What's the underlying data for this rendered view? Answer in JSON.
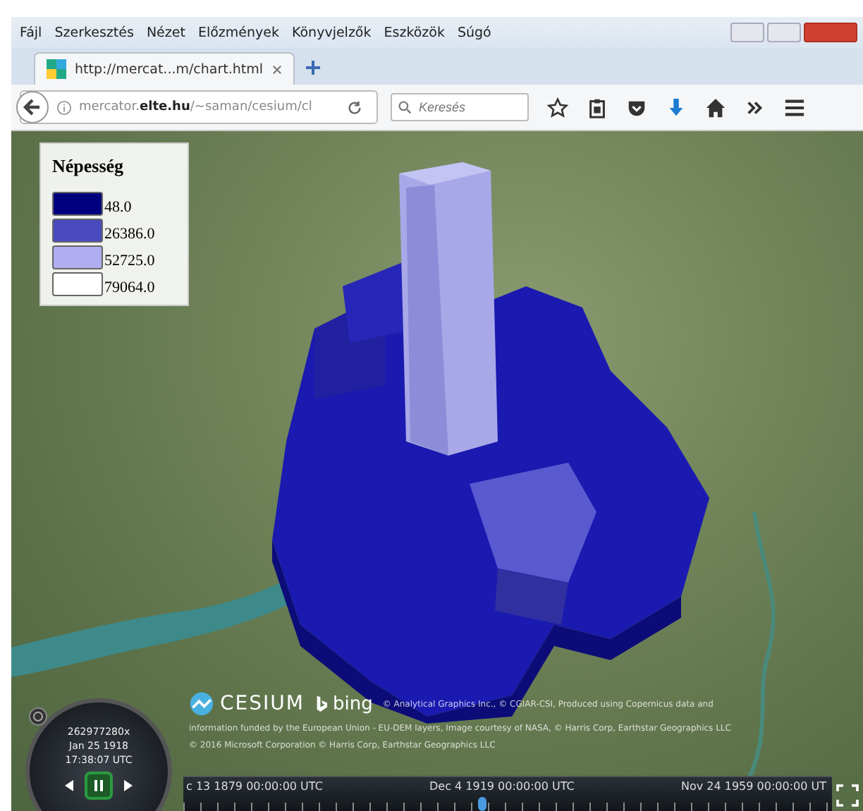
{
  "menu": [
    "Fájl",
    "Szerkesztés",
    "Nézet",
    "Előzmények",
    "Könyvjelzők",
    "Eszközök",
    "Súgó"
  ],
  "tabs": [
    {
      "title": "http://mercat...m/chart.html",
      "selected": true
    }
  ],
  "address": {
    "url": "mercator.**elte.hu**/~saman/cesium/cl",
    "search_placeholder": "Keresés"
  },
  "legend": {
    "title": "Népesség",
    "items": [
      {
        "label": "48.0",
        "color": "#00007f"
      },
      {
        "label": "26386.0",
        "color": "#4a4abf"
      },
      {
        "label": "52725.0",
        "color": "#b0aef0"
      },
      {
        "label": "79064.0",
        "color": "#ffffff"
      }
    ]
  },
  "attribution": {
    "logo": "CESIUM",
    "provider": "bing",
    "lines": [
      "© Analytical Graphics Inc., © CGIAR-CSI, Produced using Copernicus data and",
      "information funded by the European Union - EU-DEM layers, Image courtesy of NASA, © Harris Corp, Earthstar Geographics LLC",
      "© 2016 Microsoft Corporation © Harris Corp, Earthstar Geographics LLC"
    ]
  },
  "clock": {
    "speed": "262977280x",
    "date": "Jan 25 1918",
    "time": "17:38:07 UTC",
    "playing": true
  },
  "timeline": {
    "labels": [
      "c 13 1879 00:00:00 UTC",
      "Dec 4 1919 00:00:00 UTC",
      "Nov 24 1959 00:00:00 UT"
    ],
    "level": 0.46
  }
}
